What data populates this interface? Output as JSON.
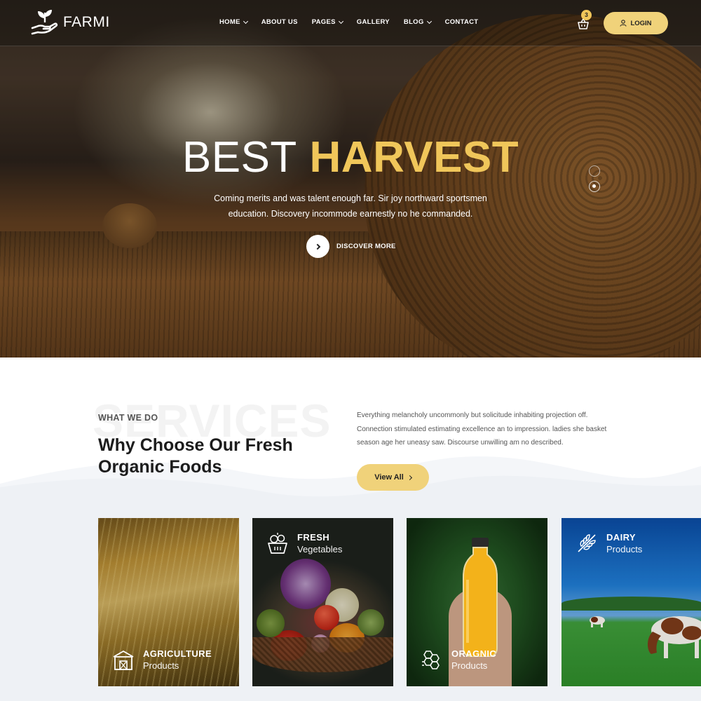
{
  "brand": {
    "name": "FARMI",
    "logo_icon": "hand-sprout-icon"
  },
  "nav": {
    "items": [
      {
        "label": "HOME",
        "dropdown": true
      },
      {
        "label": "ABOUT US",
        "dropdown": false
      },
      {
        "label": "PAGES",
        "dropdown": true
      },
      {
        "label": "GALLERY",
        "dropdown": false
      },
      {
        "label": "BLOG",
        "dropdown": true
      },
      {
        "label": "CONTACT",
        "dropdown": false
      }
    ]
  },
  "cart": {
    "count": "3",
    "icon": "basket-icon"
  },
  "login": {
    "label": "LOGIN",
    "icon": "user-icon"
  },
  "hero": {
    "title_light": "BEST",
    "title_bold": "HARVEST",
    "subtitle_line1": "Coming merits and was talent enough far. Sir joy northward sportsmen",
    "subtitle_line2": "education. Discovery incommode earnestly no he commanded.",
    "cta": "DISCOVER MORE",
    "slides_total": 2,
    "active_slide": 2
  },
  "services": {
    "watermark": "SERVICES",
    "eyebrow": "WHAT WE DO",
    "title": "Why Choose Our Fresh Organic Foods",
    "description": "Everything melancholy uncommonly but solicitude inhabiting projection off. Connection stimulated estimating excellence an to impression. ladies she basket season age her uneasy saw. Discourse unwilling am no described.",
    "view_all": "View All",
    "cards": [
      {
        "title": "AGRICULTURE",
        "subtitle": "Products",
        "icon": "barn-icon"
      },
      {
        "title": "FRESH",
        "subtitle": "Vegetables",
        "icon": "vegetable-basket-icon"
      },
      {
        "title": "ORAGNIC",
        "subtitle": "Products",
        "icon": "honeycomb-icon"
      },
      {
        "title": "DAIRY",
        "subtitle": "Products",
        "icon": "wheat-icon"
      }
    ]
  },
  "colors": {
    "accent": "#f0c65a",
    "button": "#f0d27a",
    "dark_text": "#1c1c1c",
    "section_bg": "#eef1f5"
  }
}
